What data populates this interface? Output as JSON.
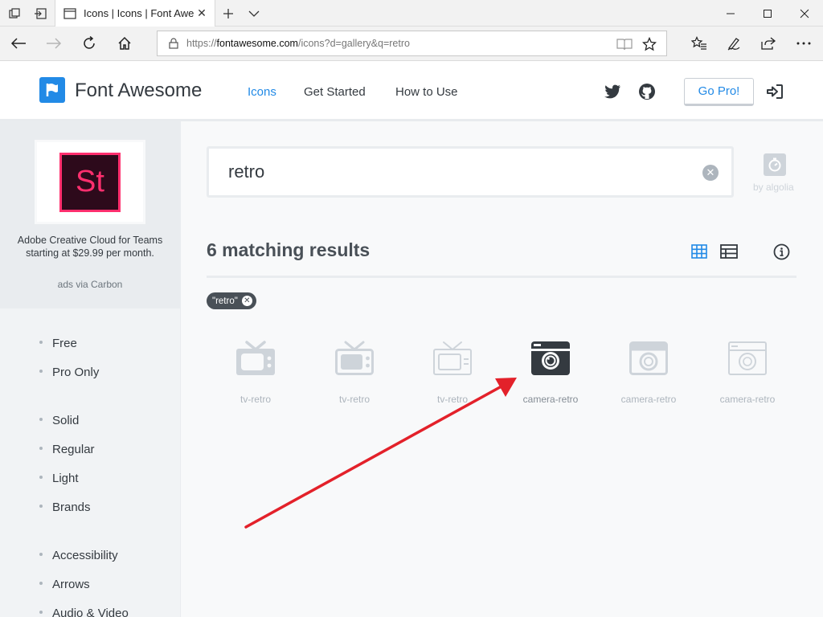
{
  "browser": {
    "tab_title": "Icons | Icons | Font Awe",
    "url_host": "fontawesome.com",
    "url_prefix": "https://",
    "url_path": "/icons?d=gallery&q=retro"
  },
  "header": {
    "brand": "Font Awesome",
    "nav": [
      "Icons",
      "Get Started",
      "How to Use"
    ],
    "active_nav": "Icons",
    "gopro_label": "Go Pro!",
    "accent_color": "#228ae6"
  },
  "sidebar": {
    "ad": {
      "logo_text": "St",
      "text": "Adobe Creative Cloud for Teams starting at $29.99 per month.",
      "via": "ads via Carbon"
    },
    "filters_license": [
      "Free",
      "Pro Only"
    ],
    "filters_style": [
      "Solid",
      "Regular",
      "Light",
      "Brands"
    ],
    "filters_category": [
      "Accessibility",
      "Arrows",
      "Audio & Video"
    ]
  },
  "main": {
    "search_value": "retro",
    "algolia_label": "by algolia",
    "results_count": "6 matching results",
    "tag": "\"retro\"",
    "results": [
      {
        "name": "tv-retro",
        "icon": "tv-retro-solid-icon"
      },
      {
        "name": "tv-retro",
        "icon": "tv-retro-regular-icon"
      },
      {
        "name": "tv-retro",
        "icon": "tv-retro-light-icon"
      },
      {
        "name": "camera-retro",
        "icon": "camera-retro-solid-icon"
      },
      {
        "name": "camera-retro",
        "icon": "camera-retro-regular-icon"
      },
      {
        "name": "camera-retro",
        "icon": "camera-retro-light-icon"
      }
    ],
    "highlighted_result": "camera-retro",
    "annotation_arrow_color": "#e3212a"
  }
}
